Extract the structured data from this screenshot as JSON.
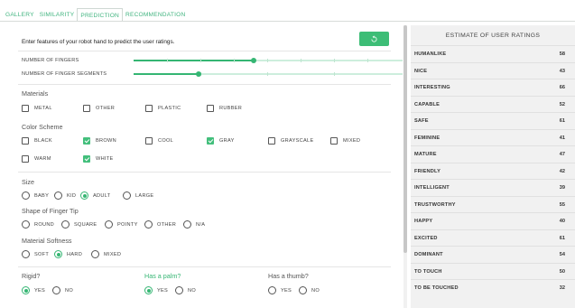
{
  "tabs": [
    {
      "label": "GALLERY",
      "active": false
    },
    {
      "label": "SIMILARITY",
      "active": false
    },
    {
      "label": "PREDICTION",
      "active": true
    },
    {
      "label": "RECOMMENDATION",
      "active": false
    }
  ],
  "intro": "Enter features of your robot hand to predict the user ratings.",
  "refresh_icon": "refresh-icon",
  "sliders": [
    {
      "label": "NUMBER OF FINGERS",
      "value_fraction": 0.445
    },
    {
      "label": "NUMBER OF FINGER SEGMENTS",
      "value_fraction": 0.243
    }
  ],
  "materials": {
    "title": "Materials",
    "options": [
      {
        "label": "METAL",
        "checked": false
      },
      {
        "label": "OTHER",
        "checked": false
      },
      {
        "label": "PLASTIC",
        "checked": false
      },
      {
        "label": "RUBBER",
        "checked": false
      }
    ]
  },
  "color_scheme": {
    "title": "Color Scheme",
    "options": [
      {
        "label": "BLACK",
        "checked": false
      },
      {
        "label": "BROWN",
        "checked": true
      },
      {
        "label": "COOL",
        "checked": false
      },
      {
        "label": "GRAY",
        "checked": true
      },
      {
        "label": "GRAYSCALE",
        "checked": false
      },
      {
        "label": "MIXED",
        "checked": false
      },
      {
        "label": "WARM",
        "checked": false
      },
      {
        "label": "WHITE",
        "checked": true
      }
    ]
  },
  "size": {
    "title": "Size",
    "options": [
      "BABY",
      "KID",
      "ADULT",
      "LARGE"
    ],
    "selected": "ADULT"
  },
  "finger_tip": {
    "title": "Shape of Finger Tip",
    "options": [
      "ROUND",
      "SQUARE",
      "POINTY",
      "OTHER",
      "N/A"
    ],
    "selected": null
  },
  "softness": {
    "title": "Material Softness",
    "options": [
      "SOFT",
      "HARD",
      "MIXED"
    ],
    "selected": "HARD"
  },
  "questions": [
    {
      "title": "Rigid?",
      "highlight": false,
      "options": [
        "YES",
        "NO"
      ],
      "selected": "YES"
    },
    {
      "title": "Has a palm?",
      "highlight": true,
      "options": [
        "YES",
        "NO"
      ],
      "selected": "YES"
    },
    {
      "title": "Has a thumb?",
      "highlight": false,
      "options": [
        "YES",
        "NO"
      ],
      "selected": null
    }
  ],
  "ratings": {
    "title": "ESTIMATE OF USER RATINGS",
    "rows": [
      {
        "label": "HUMANLIKE",
        "value": "58"
      },
      {
        "label": "NICE",
        "value": "43"
      },
      {
        "label": "INTERESTING",
        "value": "66"
      },
      {
        "label": "CAPABLE",
        "value": "52"
      },
      {
        "label": "SAFE",
        "value": "61"
      },
      {
        "label": "FEMININE",
        "value": "41"
      },
      {
        "label": "MATURE",
        "value": "47"
      },
      {
        "label": "FRIENDLY",
        "value": "42"
      },
      {
        "label": "INTELLIGENT",
        "value": "39"
      },
      {
        "label": "TRUSTWORTHY",
        "value": "55"
      },
      {
        "label": "HAPPY",
        "value": "40"
      },
      {
        "label": "EXCITED",
        "value": "61"
      },
      {
        "label": "DOMINANT",
        "value": "54"
      },
      {
        "label": "TO TOUCH",
        "value": "50"
      },
      {
        "label": "TO BE TOUCHED",
        "value": "32"
      }
    ]
  },
  "colors": {
    "accent": "#35b673",
    "panel_bg": "#f1f1f1"
  }
}
